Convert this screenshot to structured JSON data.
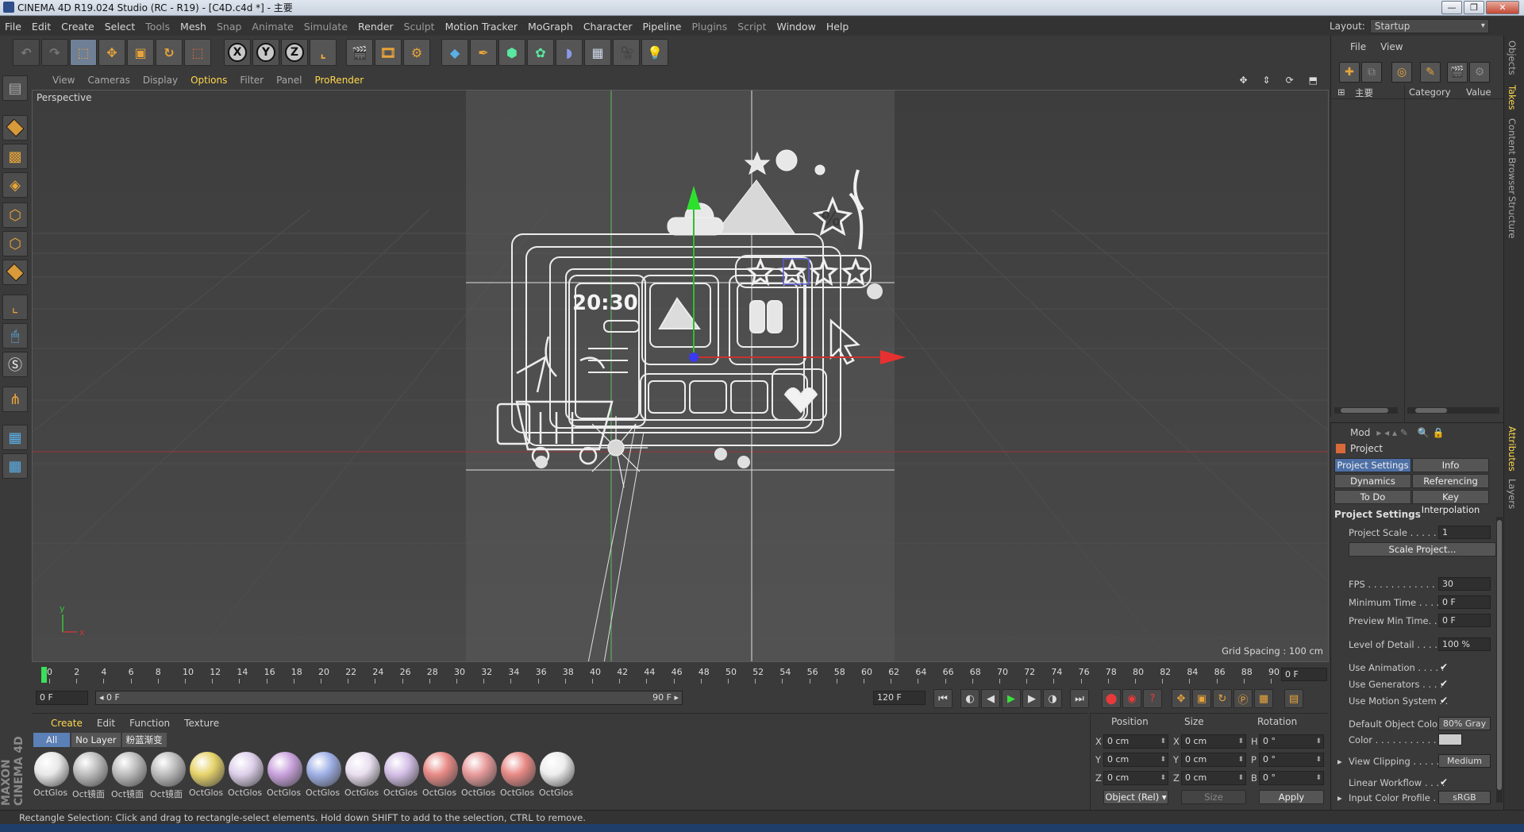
{
  "window": {
    "title": "CINEMA 4D R19.024 Studio (RC - R19) - [C4D.c4d *] - 主要",
    "btn_min": "—",
    "btn_max": "❐",
    "btn_close": "✕"
  },
  "menubar": {
    "items": [
      "File",
      "Edit",
      "Create",
      "Select",
      "Tools",
      "Mesh",
      "Snap",
      "Animate",
      "Simulate",
      "Render",
      "Sculpt",
      "Motion Tracker",
      "MoGraph",
      "Character",
      "Pipeline",
      "Plugins",
      "Script",
      "Window",
      "Help"
    ]
  },
  "layout": {
    "label": "Layout:",
    "value": "Startup"
  },
  "toolbar": {
    "axis_x": "X",
    "axis_y": "Y",
    "axis_z": "Z"
  },
  "viewport": {
    "menu": [
      "View",
      "Cameras",
      "Display",
      "Options",
      "Filter",
      "Panel",
      "ProRender"
    ],
    "label": "Perspective",
    "grid_spacing": "Grid Spacing : 100 cm",
    "axis_y": "y",
    "axis_x": "x",
    "clock": "20:30"
  },
  "timeline": {
    "ticks": [
      "0",
      "2",
      "4",
      "6",
      "8",
      "10",
      "12",
      "14",
      "16",
      "18",
      "20",
      "22",
      "24",
      "26",
      "28",
      "30",
      "32",
      "34",
      "36",
      "38",
      "40",
      "42",
      "44",
      "46",
      "48",
      "50",
      "52",
      "54",
      "56",
      "58",
      "60",
      "62",
      "64",
      "66",
      "68",
      "70",
      "72",
      "74",
      "76",
      "78",
      "80",
      "82",
      "84",
      "86",
      "88",
      "90"
    ],
    "current_frame": "0 F",
    "start_field": "0 F",
    "range_start": "◂ 0 F",
    "range_end": "90 F ▸",
    "end_field": "120 F"
  },
  "materials": {
    "menu": [
      "Create",
      "Edit",
      "Function",
      "Texture"
    ],
    "filters": [
      "All",
      "No Layer",
      "粉蓝渐变"
    ],
    "items": [
      {
        "label": "OctGlos",
        "color": "#e8e8e8"
      },
      {
        "label": "Oct镜面",
        "color": "#bdbdbd"
      },
      {
        "label": "Oct镜面",
        "color": "#bdbdbd"
      },
      {
        "label": "Oct镜面",
        "color": "#bdbdbd"
      },
      {
        "label": "OctGlos",
        "color": "#e6d36a"
      },
      {
        "label": "OctGlos",
        "color": "#ddd0ea"
      },
      {
        "label": "OctGlos",
        "color": "#c9a2dd"
      },
      {
        "label": "OctGlos",
        "color": "#9fb0e6"
      },
      {
        "label": "OctGlos",
        "color": "#e9dff0"
      },
      {
        "label": "OctGlos",
        "color": "#d4bfe6"
      },
      {
        "label": "OctGlos",
        "color": "#e88a86"
      },
      {
        "label": "OctGlos",
        "color": "#e89a9a"
      },
      {
        "label": "OctGlos",
        "color": "#e88a86"
      },
      {
        "label": "OctGlos",
        "color": "#ededed"
      }
    ]
  },
  "coords": {
    "position": "Position",
    "size": "Size",
    "rotation": "Rotation",
    "px": "0 cm",
    "py": "0 cm",
    "pz": "0 cm",
    "sx": "0 cm",
    "sy": "0 cm",
    "sz": "0 cm",
    "rh": "0 °",
    "rp": "0 °",
    "rb": "0 °",
    "lx": "X",
    "ly": "Y",
    "lz": "Z",
    "lh": "H",
    "lp": "P",
    "lb": "B",
    "mode": "Object (Rel) ▾",
    "size_mode": "Size",
    "apply": "Apply"
  },
  "status": "Rectangle Selection: Click and drag to rectangle-select elements. Hold down SHIFT to add to the selection, CTRL to remove.",
  "objects": {
    "menu": [
      "File",
      "View"
    ],
    "name_col": "主要",
    "category": "Category",
    "value": "Value"
  },
  "sidetabs": [
    "Objects",
    "Takes",
    "Content Browser",
    "Structure",
    "Attributes",
    "Layers"
  ],
  "attributes": {
    "mode": "Mod",
    "title": "Project",
    "tabs": [
      "Project Settings",
      "Info",
      "Dynamics",
      "Referencing",
      "To Do",
      "Key Interpolation"
    ],
    "section": "Project Settings",
    "project_scale": {
      "label": "Project Scale . . . . . .",
      "value": "1"
    },
    "scale_btn": "Scale Project...",
    "fps": {
      "label": "FPS . . . . . . . . . . . . .",
      "value": "30"
    },
    "min_time": {
      "label": "Minimum Time . . . . .",
      "value": "0 F"
    },
    "preview_min": {
      "label": "Preview Min Time. . .",
      "value": "0 F"
    },
    "lod": {
      "label": "Level of Detail . . . . .",
      "value": "100 %"
    },
    "use_anim": "Use Animation . . . . .",
    "use_gen": "Use Generators . . . .",
    "use_motion": "Use Motion System . .",
    "check": "✔",
    "def_color": {
      "label": "Default Object Color",
      "value": "80% Gray"
    },
    "color": "Color . . . . . . . . . . .",
    "view_clip": {
      "label": "View Clipping . . . . . .",
      "value": "Medium"
    },
    "linear": "Linear Workflow . . . .",
    "input_profile": {
      "label": "Input Color Profile . .",
      "value": "sRGB"
    }
  }
}
